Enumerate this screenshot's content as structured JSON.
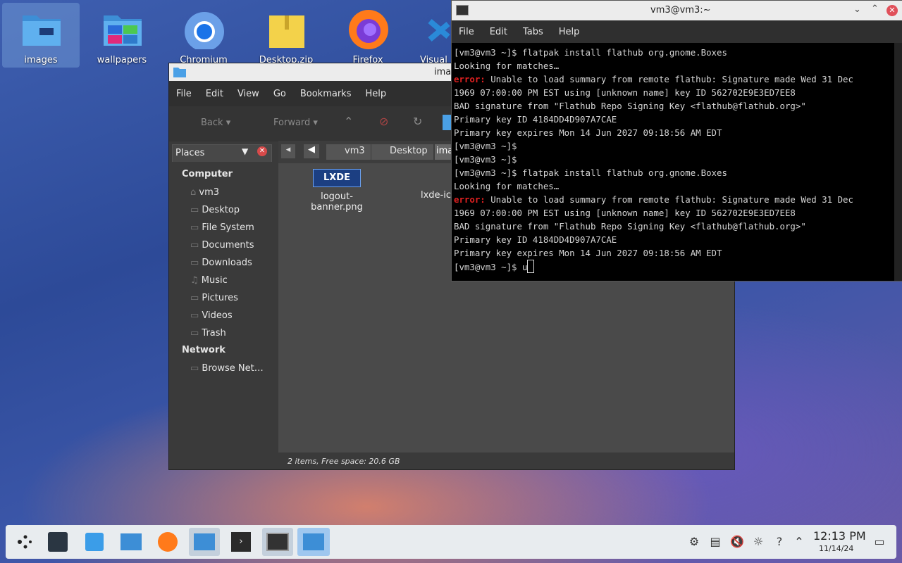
{
  "desktop": {
    "icons": [
      {
        "label": "images"
      },
      {
        "label": "wallpapers"
      },
      {
        "label": "Chromium"
      },
      {
        "label": "Desktop.zip"
      },
      {
        "label": "Firefox"
      },
      {
        "label": "Visual"
      }
    ]
  },
  "file_manager": {
    "title": "ima",
    "menu": [
      "File",
      "Edit",
      "View",
      "Go",
      "Bookmarks",
      "Help"
    ],
    "toolbar": {
      "back": "Back",
      "forward": "Forward"
    },
    "places_label": "Places",
    "sidebar": {
      "computer_header": "Computer",
      "items": [
        "vm3",
        "Desktop",
        "File System",
        "Documents",
        "Downloads",
        "Music",
        "Pictures",
        "Videos",
        "Trash"
      ],
      "network_header": "Network",
      "network_items": [
        "Browse Net…"
      ]
    },
    "path": [
      "vm3",
      "Desktop",
      "ima"
    ],
    "files": [
      {
        "name": "logout-banner.png",
        "badge": "LXDE"
      },
      {
        "name": "lxde-ico"
      }
    ],
    "status": "2 items, Free space: 20.6 GB"
  },
  "terminal": {
    "title": "vm3@vm3:~",
    "menu": [
      "File",
      "Edit",
      "Tabs",
      "Help"
    ],
    "lines": [
      {
        "text": "[vm3@vm3 ~]$ flatpak install flathub org.gnome.Boxes"
      },
      {
        "text": "Looking for matches…"
      },
      {
        "err": "error:",
        "text": " Unable to load summary from remote flathub: Signature made Wed 31 Dec"
      },
      {
        "text": "1969 07:00:00 PM EST using [unknown name] key ID 562702E9E3ED7EE8"
      },
      {
        "text": "BAD signature from \"Flathub Repo Signing Key <flathub@flathub.org>\""
      },
      {
        "text": "Primary key ID 4184DD4D907A7CAE"
      },
      {
        "text": "Primary key expires Mon 14 Jun 2027 09:18:56 AM EDT"
      },
      {
        "text": "[vm3@vm3 ~]$"
      },
      {
        "text": "[vm3@vm3 ~]$"
      },
      {
        "text": "[vm3@vm3 ~]$ flatpak install flathub org.gnome.Boxes"
      },
      {
        "text": "Looking for matches…"
      },
      {
        "err": "error:",
        "text": " Unable to load summary from remote flathub: Signature made Wed 31 Dec"
      },
      {
        "text": "1969 07:00:00 PM EST using [unknown name] key ID 562702E9E3ED7EE8"
      },
      {
        "text": "BAD signature from \"Flathub Repo Signing Key <flathub@flathub.org>\""
      },
      {
        "text": "Primary key ID 4184DD4D907A7CAE"
      },
      {
        "text": "Primary key expires Mon 14 Jun 2027 09:18:56 AM EDT"
      }
    ],
    "prompt": "[vm3@vm3 ~]$ ",
    "input": "u"
  },
  "taskbar": {
    "clock_time": "12:13 PM",
    "clock_date": "11/14/24"
  },
  "colors": {
    "accent": "#9fc7ef",
    "error": "#e02020",
    "close": "#e0505a"
  }
}
